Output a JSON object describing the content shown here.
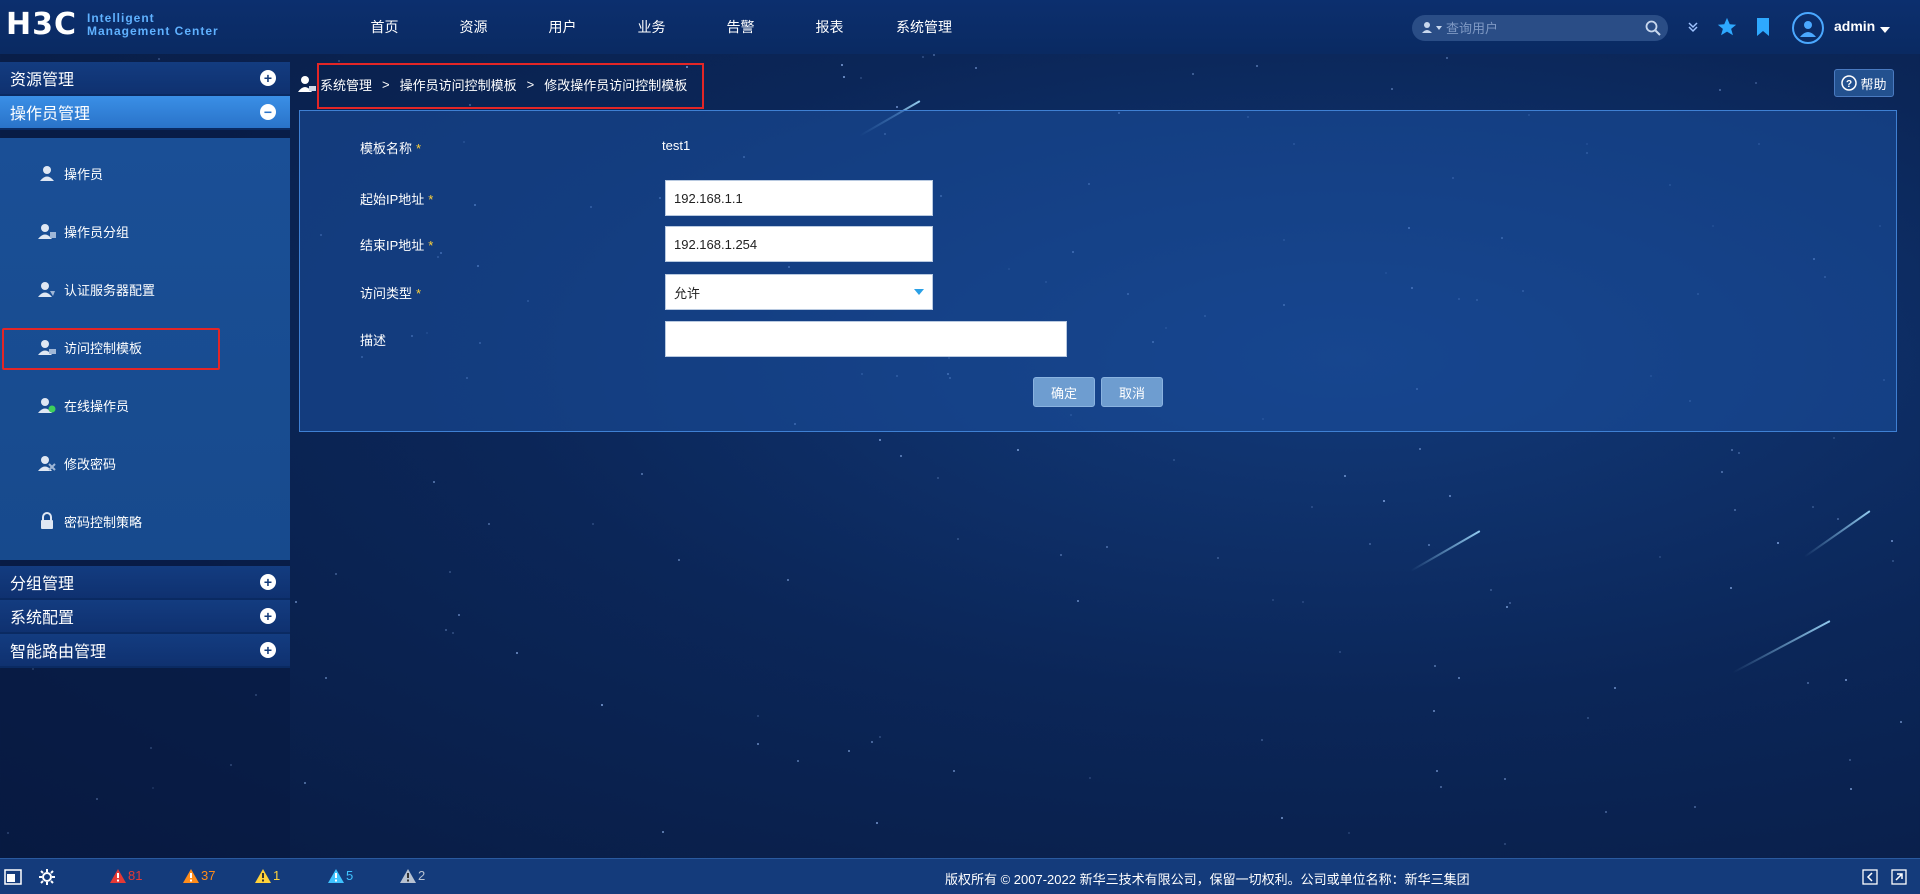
{
  "app": {
    "logo_mark": "H3C",
    "logo_line1": "Intelligent",
    "logo_line2": "Management Center"
  },
  "nav": [
    "首页",
    "资源",
    "用户",
    "业务",
    "告警",
    "报表",
    "系统管理"
  ],
  "search": {
    "placeholder": "查询用户"
  },
  "user": {
    "name": "admin"
  },
  "sidebar": {
    "sections": [
      {
        "label": "资源管理",
        "expanded": false
      },
      {
        "label": "操作员管理",
        "expanded": true
      }
    ],
    "items": [
      {
        "label": "操作员",
        "icon": "user-icon"
      },
      {
        "label": "操作员分组",
        "icon": "user-group-icon"
      },
      {
        "label": "认证服务器配置",
        "icon": "auth-server-icon"
      },
      {
        "label": "访问控制模板",
        "icon": "access-template-icon",
        "selected": true
      },
      {
        "label": "在线操作员",
        "icon": "online-user-icon"
      },
      {
        "label": "修改密码",
        "icon": "change-password-icon"
      },
      {
        "label": "密码控制策略",
        "icon": "lock-icon"
      }
    ],
    "after_sections": [
      {
        "label": "分组管理"
      },
      {
        "label": "系统配置"
      },
      {
        "label": "智能路由管理"
      }
    ]
  },
  "breadcrumb": [
    "系统管理",
    "操作员访问控制模板",
    "修改操作员访问控制模板"
  ],
  "help": {
    "label": "帮助"
  },
  "form": {
    "template_name_label": "模板名称",
    "template_name_value": "test1",
    "start_ip_label": "起始IP地址",
    "start_ip_value": "192.168.1.1",
    "end_ip_label": "结束IP地址",
    "end_ip_value": "192.168.1.254",
    "access_type_label": "访问类型",
    "access_type_value": "允许",
    "desc_label": "描述",
    "desc_value": "",
    "required_mark": "*",
    "ok_label": "确定",
    "cancel_label": "取消"
  },
  "alarms": [
    {
      "count": "81",
      "color": "#e53935"
    },
    {
      "count": "37",
      "color": "#ff8c1a"
    },
    {
      "count": "1",
      "color": "#ffd23a"
    },
    {
      "count": "5",
      "color": "#3fc3ff"
    },
    {
      "count": "2",
      "color": "#b7c2d2"
    }
  ],
  "footer": {
    "copyright": "版权所有 © 2007-2022 新华三技术有限公司，保留一切权利。公司或单位名称：新华三集团"
  }
}
